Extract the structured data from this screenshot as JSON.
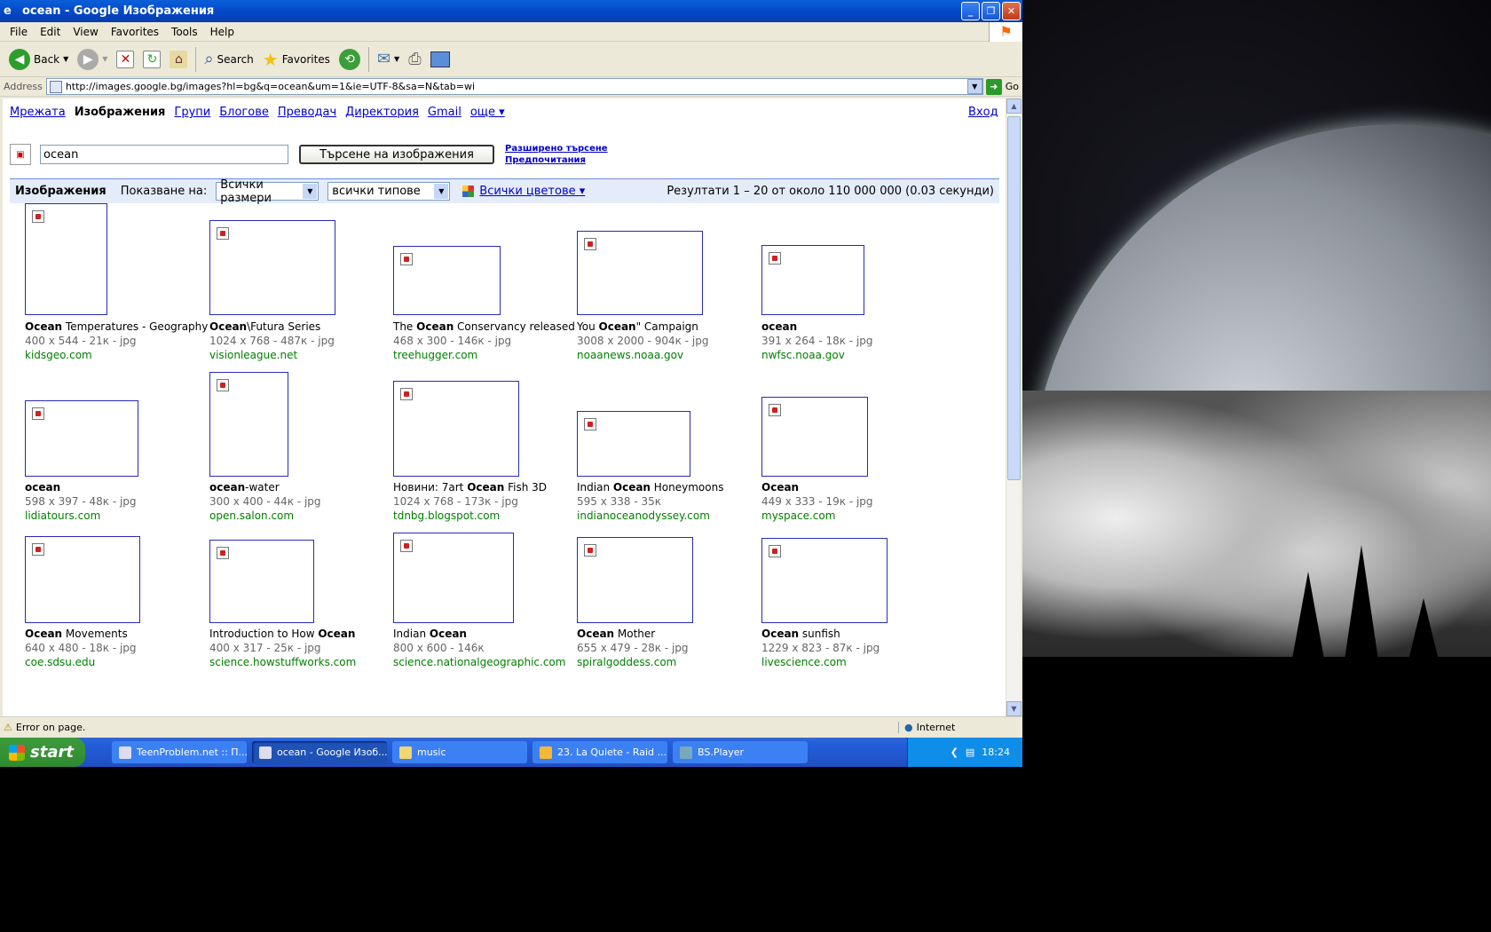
{
  "window": {
    "title": "ocean - Google Изображения"
  },
  "menu": [
    "File",
    "Edit",
    "View",
    "Favorites",
    "Tools",
    "Help"
  ],
  "toolbar": {
    "back": "Back",
    "search": "Search",
    "favorites": "Favorites"
  },
  "address": {
    "label": "Address",
    "url": "http://images.google.bg/images?hl=bg&q=ocean&um=1&ie=UTF-8&sa=N&tab=wi",
    "go": "Go"
  },
  "nav": {
    "items": [
      "Мрежата",
      "Изображения",
      "Групи",
      "Блогове",
      "Преводач",
      "Директория",
      "Gmail",
      "още ▾"
    ],
    "signin": "Вход"
  },
  "search": {
    "query": "ocean",
    "button": "Търсене на изображения",
    "advanced": "Разширено търсене",
    "prefs": "Предпочитания"
  },
  "filter": {
    "label": "Изображения",
    "show_on": "Показване на:",
    "size": "Всички размери",
    "type": "всички типове",
    "colors": "Всички цветове ▾",
    "results": "Резултати 1 – 20 от около 110 000 000 (0.03 секунди)"
  },
  "results": [
    {
      "title_pre": "",
      "title_bold": "Ocean",
      "title_post": " Temperatures - Geography",
      "meta": "400 x 544 - 21к - jpg",
      "site": "kidsgeo.com"
    },
    {
      "title_pre": "",
      "title_bold": "Ocean",
      "title_post": "\\Futura Series",
      "meta": "1024 x 768 - 487к - jpg",
      "site": "visionleague.net"
    },
    {
      "title_pre": "The ",
      "title_bold": "Ocean",
      "title_post": " Conservancy released",
      "meta": "468 x 300 - 146к - jpg",
      "site": "treehugger.com"
    },
    {
      "title_pre": "You ",
      "title_bold": "Ocean",
      "title_post": "\" Campaign",
      "meta": "3008 x 2000 - 904к - jpg",
      "site": "noaanews.noaa.gov"
    },
    {
      "title_pre": "",
      "title_bold": "ocean",
      "title_post": "",
      "meta": "391 x 264 - 18к - jpg",
      "site": "nwfsc.noaa.gov"
    },
    {
      "title_pre": "",
      "title_bold": "ocean",
      "title_post": "",
      "meta": "598 x 397 - 48к - jpg",
      "site": "lidiatours.com"
    },
    {
      "title_pre": "",
      "title_bold": "ocean",
      "title_post": "-water",
      "meta": "300 x 400 - 44к - jpg",
      "site": "open.salon.com"
    },
    {
      "title_pre": "Новини: 7art ",
      "title_bold": "Ocean",
      "title_post": " Fish 3D",
      "meta": "1024 x 768 - 173к - jpg",
      "site": "tdnbg.blogspot.com"
    },
    {
      "title_pre": "Indian ",
      "title_bold": "Ocean",
      "title_post": " Honeymoons",
      "meta": "595 x 338 - 35к",
      "site": "indianoceanodyssey.com"
    },
    {
      "title_pre": "",
      "title_bold": "Ocean",
      "title_post": "",
      "meta": "449 x 333 - 19к - jpg",
      "site": "myspace.com"
    },
    {
      "title_pre": "",
      "title_bold": "Ocean",
      "title_post": " Movements",
      "meta": "640 x 480 - 18к - jpg",
      "site": "coe.sdsu.edu"
    },
    {
      "title_pre": "Introduction to How ",
      "title_bold": "Ocean",
      "title_post": "",
      "meta": "400 x 317 - 25к - jpg",
      "site": "science.howstuffworks.com"
    },
    {
      "title_pre": "Indian ",
      "title_bold": "Ocean",
      "title_post": "",
      "meta": "800 x 600 - 146к",
      "site": "science.nationalgeographic.com"
    },
    {
      "title_pre": "",
      "title_bold": "Ocean",
      "title_post": " Mother",
      "meta": "655 x 479 - 28к - jpg",
      "site": "spiralgoddess.com"
    },
    {
      "title_pre": "",
      "title_bold": "Ocean",
      "title_post": " sunfish",
      "meta": "1229 x 823 - 87к - jpg",
      "site": "livescience.com"
    }
  ],
  "status": {
    "text": "Error on page.",
    "zone": "Internet"
  },
  "taskbar": {
    "start": "start",
    "tasks": [
      "TeenProblem.net :: П...",
      "ocean - Google Изоб...",
      "music",
      "23. La Quiete - Raid ...",
      "BS.Player"
    ],
    "clock": "18:24"
  }
}
